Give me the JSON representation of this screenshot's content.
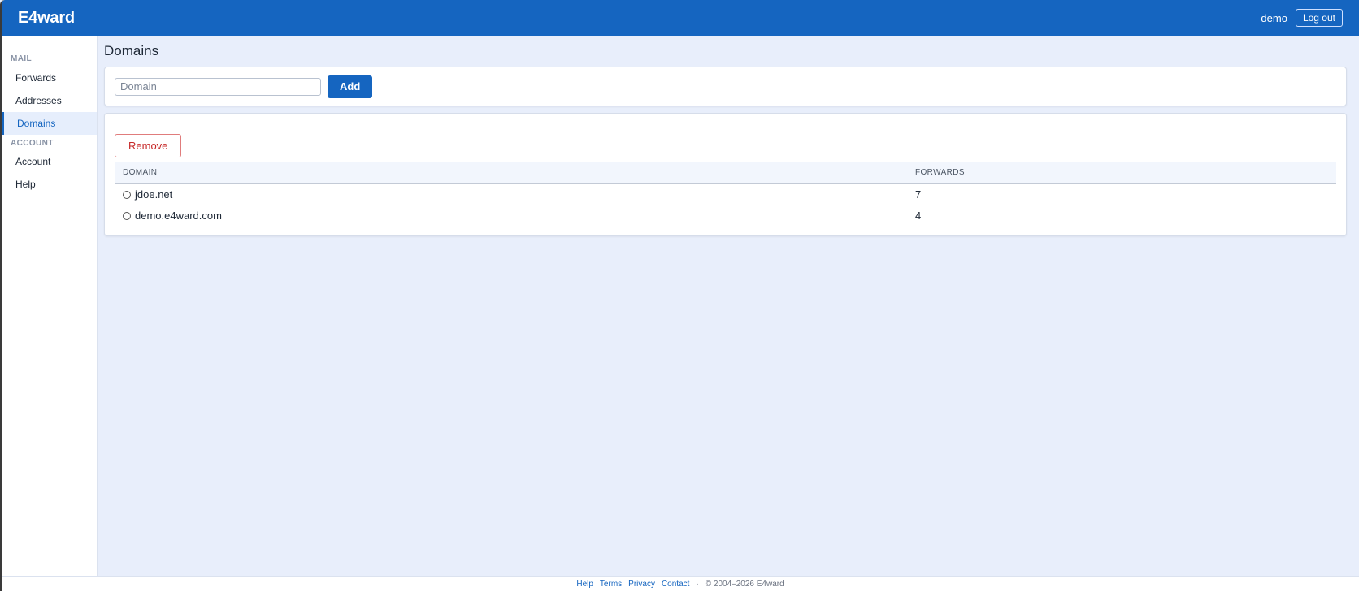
{
  "header": {
    "brand": "E4ward",
    "user": "demo",
    "logout_label": "Log out"
  },
  "sidebar": {
    "sections": [
      {
        "title": "MAIL",
        "items": [
          {
            "label": "Forwards"
          },
          {
            "label": "Addresses"
          },
          {
            "label": "Domains",
            "active": true
          }
        ]
      },
      {
        "title": "ACCOUNT",
        "items": [
          {
            "label": "Account"
          },
          {
            "label": "Help"
          }
        ]
      }
    ]
  },
  "main": {
    "title": "Domains",
    "add_form": {
      "placeholder": "Domain",
      "add_label": "Add"
    },
    "remove_label": "Remove",
    "table": {
      "columns": [
        "DOMAIN",
        "FORWARDS"
      ],
      "rows": [
        {
          "domain": "jdoe.net",
          "forwards": "7"
        },
        {
          "domain": "demo.e4ward.com",
          "forwards": "4"
        }
      ]
    }
  },
  "footer": {
    "links": [
      "Help",
      "Terms",
      "Privacy",
      "Contact"
    ],
    "separator": "·",
    "copyright": "© 2004–2026 E4ward"
  },
  "colors": {
    "primary": "#1565c0",
    "background": "#e8eefb",
    "danger": "#c62828"
  }
}
